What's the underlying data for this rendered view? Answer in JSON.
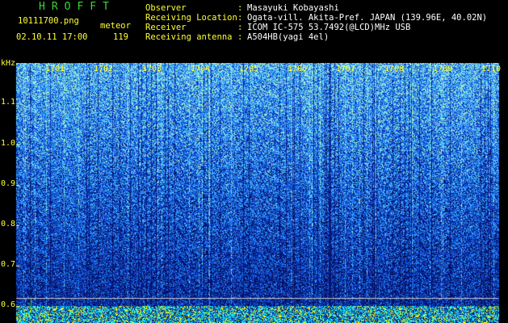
{
  "logo": "HROFFT",
  "file": {
    "name": "10111700.png",
    "type_label": "meteor",
    "datetime": "02.10.11 17:00",
    "count": "119"
  },
  "info": [
    {
      "label": "Observer",
      "value": "Masayuki Kobayashi"
    },
    {
      "label": "Receiving Location",
      "value": "Ogata-vill. Akita-Pref. JAPAN (139.96E, 40.02N)"
    },
    {
      "label": "Receiver",
      "value": "ICOM IC-575 53.7492(@LCD)MHz USB"
    },
    {
      "label": "Receiving antenna",
      "value": "A504HB(yagi 4el)"
    }
  ],
  "chart_data": {
    "type": "heatmap",
    "ylabel": "kHz",
    "y_ticks": [
      "1.1",
      "1.0",
      "0.9",
      "0.8",
      "0.7",
      "0.6"
    ],
    "x_ticks": [
      "1701",
      "1702",
      "1703",
      "1704",
      "1705",
      "1706",
      "1707",
      "1708",
      "1709",
      "1710"
    ],
    "colors": {
      "low": "#0a1a8c",
      "mid": "#1e64ff",
      "high": "#50c8ff",
      "peak": "#ffff00",
      "marker": "#3cdc3c"
    }
  }
}
